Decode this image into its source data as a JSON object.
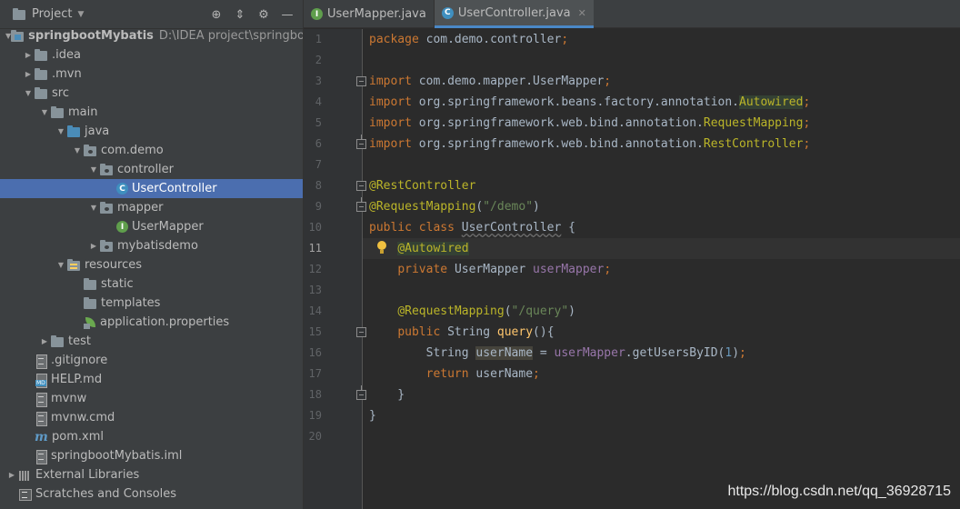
{
  "project_panel": {
    "title": "Project",
    "tree": [
      {
        "label": "springbootMybatis",
        "path": "D:\\IDEA project\\springbootM",
        "depth": 0,
        "arrow": "down",
        "icon": "module-folder-icon",
        "bold": true
      },
      {
        "label": ".idea",
        "depth": 1,
        "arrow": "right",
        "icon": "folder-icon"
      },
      {
        "label": ".mvn",
        "depth": 1,
        "arrow": "right",
        "icon": "folder-icon"
      },
      {
        "label": "src",
        "depth": 1,
        "arrow": "down",
        "icon": "folder-icon"
      },
      {
        "label": "main",
        "depth": 2,
        "arrow": "down",
        "icon": "folder-icon"
      },
      {
        "label": "java",
        "depth": 3,
        "arrow": "down",
        "icon": "source-folder-icon"
      },
      {
        "label": "com.demo",
        "depth": 4,
        "arrow": "down",
        "icon": "package-icon"
      },
      {
        "label": "controller",
        "depth": 5,
        "arrow": "down",
        "icon": "package-icon"
      },
      {
        "label": "UserController",
        "depth": 6,
        "arrow": "none",
        "icon": "java-class-icon",
        "selected": true
      },
      {
        "label": "mapper",
        "depth": 5,
        "arrow": "down",
        "icon": "package-icon"
      },
      {
        "label": "UserMapper",
        "depth": 6,
        "arrow": "none",
        "icon": "java-interface-icon"
      },
      {
        "label": "mybatisdemo",
        "depth": 5,
        "arrow": "right",
        "icon": "package-icon"
      },
      {
        "label": "resources",
        "depth": 3,
        "arrow": "down",
        "icon": "resources-folder-icon"
      },
      {
        "label": "static",
        "depth": 4,
        "arrow": "none",
        "icon": "folder-icon"
      },
      {
        "label": "templates",
        "depth": 4,
        "arrow": "none",
        "icon": "folder-icon"
      },
      {
        "label": "application.properties",
        "depth": 4,
        "arrow": "none",
        "icon": "spring-properties-icon"
      },
      {
        "label": "test",
        "depth": 2,
        "arrow": "right",
        "icon": "folder-icon"
      },
      {
        "label": ".gitignore",
        "depth": 1,
        "arrow": "none",
        "icon": "text-file-icon"
      },
      {
        "label": "HELP.md",
        "depth": 1,
        "arrow": "none",
        "icon": "markdown-file-icon"
      },
      {
        "label": "mvnw",
        "depth": 1,
        "arrow": "none",
        "icon": "text-file-icon"
      },
      {
        "label": "mvnw.cmd",
        "depth": 1,
        "arrow": "none",
        "icon": "text-file-icon"
      },
      {
        "label": "pom.xml",
        "depth": 1,
        "arrow": "none",
        "icon": "maven-icon"
      },
      {
        "label": "springbootMybatis.iml",
        "depth": 1,
        "arrow": "none",
        "icon": "text-file-icon"
      },
      {
        "label": "External Libraries",
        "depth": 0,
        "arrow": "right",
        "icon": "libraries-icon"
      },
      {
        "label": "Scratches and Consoles",
        "depth": 0,
        "arrow": "none",
        "icon": "scratches-icon"
      }
    ]
  },
  "tabs": [
    {
      "label": "UserMapper.java",
      "kind": "I",
      "active": false
    },
    {
      "label": "UserController.java",
      "kind": "C",
      "active": true
    }
  ],
  "editor": {
    "current_line": 11,
    "lines": [
      {
        "n": "1",
        "tokens": [
          {
            "t": "package ",
            "c": "k"
          },
          {
            "t": "com.demo.controller",
            "c": "plain"
          },
          {
            "t": ";",
            "c": "k"
          }
        ]
      },
      {
        "n": "2",
        "tokens": []
      },
      {
        "n": "3",
        "fold": "start",
        "tokens": [
          {
            "t": "import ",
            "c": "k"
          },
          {
            "t": "com.demo.mapper.UserMapper",
            "c": "plain"
          },
          {
            "t": ";",
            "c": "k"
          }
        ]
      },
      {
        "n": "4",
        "tokens": [
          {
            "t": "import ",
            "c": "k"
          },
          {
            "t": "org.springframework.beans.factory.annotation.",
            "c": "plain"
          },
          {
            "t": "Autowired",
            "c": "a ann-hl"
          },
          {
            "t": ";",
            "c": "k"
          }
        ]
      },
      {
        "n": "5",
        "tokens": [
          {
            "t": "import ",
            "c": "k"
          },
          {
            "t": "org.springframework.web.bind.annotation.",
            "c": "plain"
          },
          {
            "t": "RequestMapping",
            "c": "a"
          },
          {
            "t": ";",
            "c": "k"
          }
        ]
      },
      {
        "n": "6",
        "fold": "end",
        "tokens": [
          {
            "t": "import ",
            "c": "k"
          },
          {
            "t": "org.springframework.web.bind.annotation.",
            "c": "plain"
          },
          {
            "t": "RestController",
            "c": "a"
          },
          {
            "t": ";",
            "c": "k"
          }
        ]
      },
      {
        "n": "7",
        "tokens": []
      },
      {
        "n": "8",
        "fold": "start",
        "tokens": [
          {
            "t": "@RestController",
            "c": "a"
          }
        ]
      },
      {
        "n": "9",
        "fold": "end",
        "tokens": [
          {
            "t": "@RequestMapping",
            "c": "a"
          },
          {
            "t": "(",
            "c": "plain"
          },
          {
            "t": "\"/demo\"",
            "c": "s"
          },
          {
            "t": ")",
            "c": "plain"
          }
        ]
      },
      {
        "n": "10",
        "tokens": [
          {
            "t": "public class ",
            "c": "k"
          },
          {
            "t": "UserController",
            "c": "plain warn"
          },
          {
            "t": " {",
            "c": "plain"
          }
        ]
      },
      {
        "n": "11",
        "bulb": true,
        "tokens": [
          {
            "t": "    ",
            "c": "plain"
          },
          {
            "t": "@Autowired",
            "c": "a ann-hl"
          }
        ]
      },
      {
        "n": "12",
        "tokens": [
          {
            "t": "    ",
            "c": "plain"
          },
          {
            "t": "private ",
            "c": "k"
          },
          {
            "t": "UserMapper ",
            "c": "plain"
          },
          {
            "t": "userMapper",
            "c": "f"
          },
          {
            "t": ";",
            "c": "k"
          }
        ]
      },
      {
        "n": "13",
        "tokens": []
      },
      {
        "n": "14",
        "tokens": [
          {
            "t": "    ",
            "c": "plain"
          },
          {
            "t": "@RequestMapping",
            "c": "a"
          },
          {
            "t": "(",
            "c": "plain"
          },
          {
            "t": "\"/query\"",
            "c": "s"
          },
          {
            "t": ")",
            "c": "plain"
          }
        ]
      },
      {
        "n": "15",
        "fold": "start",
        "tokens": [
          {
            "t": "    ",
            "c": "plain"
          },
          {
            "t": "public ",
            "c": "k"
          },
          {
            "t": "String ",
            "c": "plain"
          },
          {
            "t": "query",
            "c": "mth"
          },
          {
            "t": "(){",
            "c": "plain"
          }
        ]
      },
      {
        "n": "16",
        "tokens": [
          {
            "t": "        String ",
            "c": "plain"
          },
          {
            "t": "userName",
            "c": "plain var-hl"
          },
          {
            "t": " = ",
            "c": "plain"
          },
          {
            "t": "userMapper",
            "c": "f"
          },
          {
            "t": ".getUsersByID(",
            "c": "plain"
          },
          {
            "t": "1",
            "c": "n"
          },
          {
            "t": ")",
            "c": "plain"
          },
          {
            "t": ";",
            "c": "k"
          }
        ]
      },
      {
        "n": "17",
        "tokens": [
          {
            "t": "        ",
            "c": "plain"
          },
          {
            "t": "return ",
            "c": "k"
          },
          {
            "t": "userName",
            "c": "plain"
          },
          {
            "t": ";",
            "c": "k"
          }
        ]
      },
      {
        "n": "18",
        "fold": "end",
        "tokens": [
          {
            "t": "    }",
            "c": "plain"
          }
        ]
      },
      {
        "n": "19",
        "tokens": [
          {
            "t": "}",
            "c": "plain"
          }
        ]
      },
      {
        "n": "20",
        "tokens": []
      }
    ]
  },
  "watermark": "https://blog.csdn.net/qq_36928715"
}
